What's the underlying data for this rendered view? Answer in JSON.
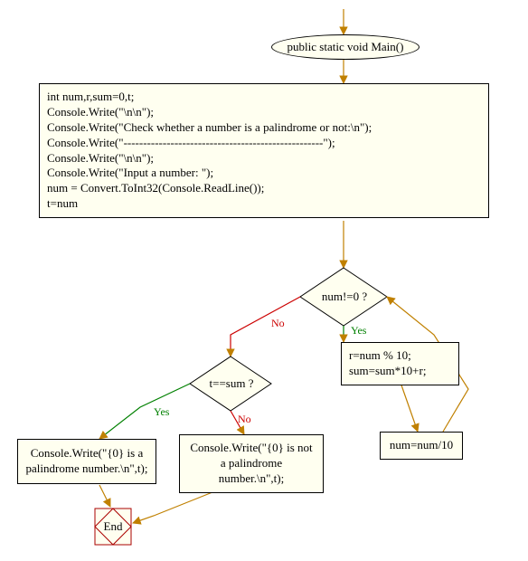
{
  "start": {
    "label": "public static void Main()"
  },
  "code_block": {
    "lines": [
      "int num,r,sum=0,t;",
      "Console.Write(\"\\n\\n\");",
      "Console.Write(\"Check whether a number is a palindrome or not:\\n\");",
      "Console.Write(\"---------------------------------------------------\");",
      "Console.Write(\"\\n\\n\");",
      "Console.Write(\"Input a number: \");",
      "num = Convert.ToInt32(Console.ReadLine());",
      "t=num"
    ]
  },
  "dec1": {
    "label": "num!=0 ?",
    "yes": "Yes",
    "no": "No"
  },
  "dec2": {
    "label": "t==sum ?",
    "yes": "Yes",
    "no": "No"
  },
  "loop_body": {
    "line1": "r=num % 10;",
    "line2": "sum=sum*10+r;"
  },
  "loop_update": {
    "text": "num=num/10"
  },
  "out_yes": {
    "text": "Console.Write(\"{0} is a palindrome number.\\n\",t);"
  },
  "out_no": {
    "text": "Console.Write(\"{0} is not a palindrome number.\\n\",t);"
  },
  "end": {
    "label": "End"
  }
}
